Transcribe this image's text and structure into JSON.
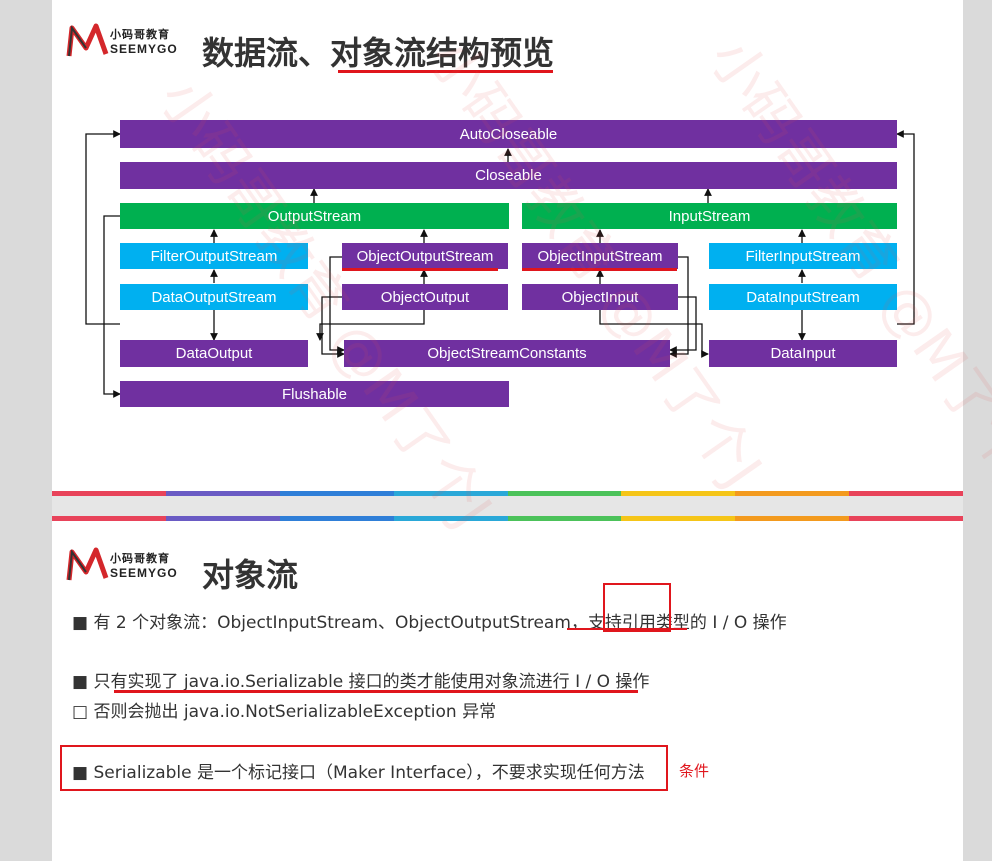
{
  "logo": {
    "cn": "小码哥教育",
    "en": "SEEMYGO"
  },
  "slide1": {
    "title_part1": "数据流、",
    "title_part2": "对象流结构预览",
    "boxes": {
      "autocloseable": "AutoCloseable",
      "closeable": "Closeable",
      "outputstream": "OutputStream",
      "inputstream": "InputStream",
      "filteroutputstream": "FilterOutputStream",
      "objectoutputstream": "ObjectOutputStream",
      "objectinputstream": "ObjectInputStream",
      "filterinputstream": "FilterInputStream",
      "dataoutputstream": "DataOutputStream",
      "objectoutput": "ObjectOutput",
      "objectinput": "ObjectInput",
      "datainputstream": "DataInputStream",
      "dataoutput": "DataOutput",
      "objectstreamconstants": "ObjectStreamConstants",
      "datainput": "DataInput",
      "flushable": "Flushable"
    }
  },
  "slide2": {
    "title": "对象流",
    "bullet1": "■ 有 2 个对象流：ObjectInputStream、ObjectOutputStream，支持引用类型的 I / O 操作",
    "bullet2": "■ 只有实现了 java.io.Serializable 接口的类才能使用对象流进行 I / O 操作",
    "bullet3": "□ 否则会抛出  java.io.NotSerializableException 异常",
    "bullet4": "■ Serializable 是一个标记接口（Maker Interface），不要求实现任何方法",
    "note": "条件"
  },
  "colors": {
    "purple": "#7030a0",
    "green": "#00b050",
    "blue": "#00b0f0",
    "red": "#e0161d",
    "stripe": [
      "#e8435a",
      "#6a5bc4",
      "#2f7fd8",
      "#2aa8d8",
      "#4cc25a",
      "#f5c518",
      "#f39a1e",
      "#e8435a"
    ]
  },
  "watermark": "小码哥教育 @M了个J"
}
